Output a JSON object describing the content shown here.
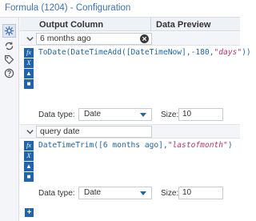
{
  "window": {
    "title": "Formula (1204) - Configuration"
  },
  "columns": {
    "output": "Output Column",
    "preview": "Data Preview"
  },
  "rail": [
    {
      "name": "gear-icon"
    },
    {
      "name": "cycle-icon"
    },
    {
      "name": "tag-icon"
    },
    {
      "name": "help-icon"
    }
  ],
  "expressions": [
    {
      "output_name": "6 months ago",
      "expr_parts": [
        {
          "t": "kw",
          "v": "ToDate(DateTimeAdd([DateTimeNow],-180,"
        },
        {
          "t": "str",
          "v": "\"days\""
        },
        {
          "t": "kw",
          "v": "))"
        }
      ],
      "type_label": "Data type:",
      "type_value": "Date",
      "size_label": "Size:",
      "size_value": "10"
    },
    {
      "output_name": "query date",
      "expr_parts": [
        {
          "t": "kw",
          "v": "DateTimeTrim([6 months ago],"
        },
        {
          "t": "str",
          "v": "\"lastofmonth\""
        },
        {
          "t": "kw",
          "v": ")"
        }
      ],
      "type_label": "Data type:",
      "type_value": "Date",
      "size_label": "Size:",
      "size_value": "10"
    }
  ],
  "toolbar_icons": [
    "fx-icon",
    "x-variable-icon",
    "folder-icon",
    "save-icon"
  ],
  "colors": {
    "accent": "#1f64ad",
    "title": "#3d6fb4",
    "string": "#b8326f"
  },
  "add_label": "+"
}
